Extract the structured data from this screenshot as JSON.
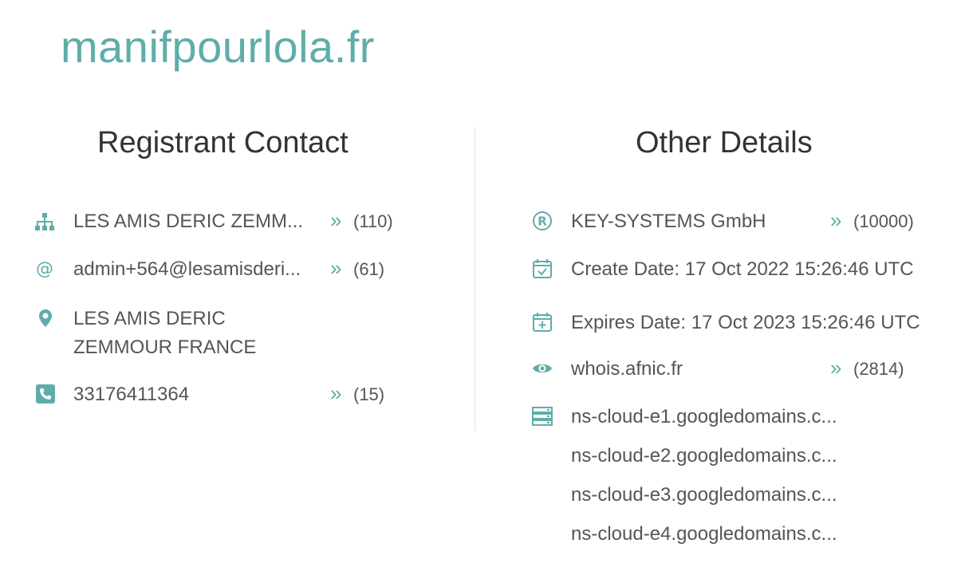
{
  "domain": "manifpourlola.fr",
  "registrant": {
    "title": "Registrant Contact",
    "organization": "LES AMIS DERIC ZEMM...",
    "organization_count": "(110)",
    "email": "admin+564@lesamisderi...",
    "email_count": "(61)",
    "address_line1": "LES AMIS DERIC",
    "address_line2": "ZEMMOUR FRANCE",
    "phone": "33176411364",
    "phone_count": "(15)"
  },
  "other": {
    "title": "Other Details",
    "registrar": "KEY-SYSTEMS GmbH",
    "registrar_count": "(10000)",
    "create_date": "Create Date: 17 Oct 2022 15:26:46 UTC",
    "expires_date": "Expires Date: 17 Oct 2023 15:26:46 UTC",
    "whois": "whois.afnic.fr",
    "whois_count": "(2814)",
    "nameservers": [
      "ns-cloud-e1.googledomains.c...",
      "ns-cloud-e2.googledomains.c...",
      "ns-cloud-e3.googledomains.c...",
      "ns-cloud-e4.googledomains.c..."
    ]
  },
  "arrow_glyph": "»",
  "colors": {
    "accent": "#5fada8",
    "text": "#555555",
    "heading": "#333333"
  }
}
